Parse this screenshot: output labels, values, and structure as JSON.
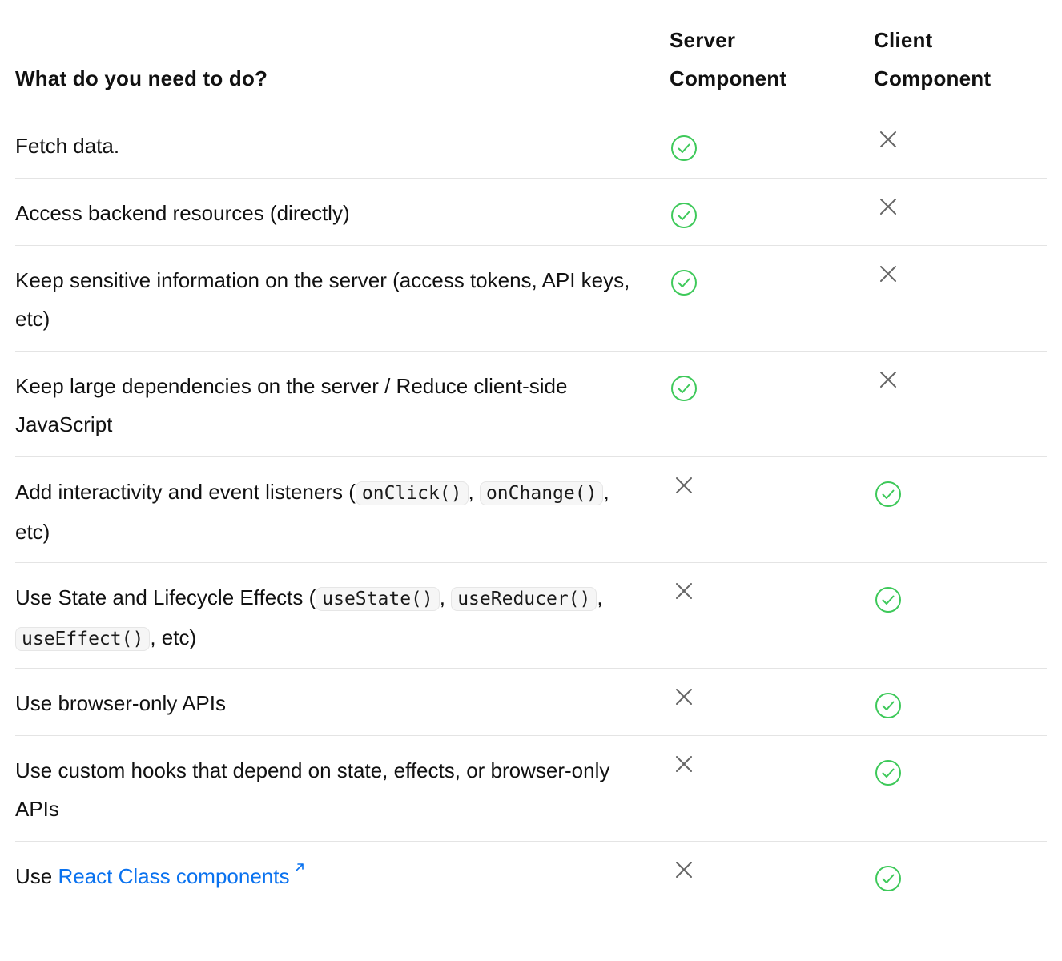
{
  "header": {
    "task_label": "What do you need to do?",
    "server_label_line1": "Server",
    "server_label_line2": "Component",
    "client_label_line1": "Client",
    "client_label_line2": "Component"
  },
  "rows": [
    {
      "text": "Fetch data.",
      "server": "check",
      "client": "cross"
    },
    {
      "text": "Access backend resources (directly)",
      "server": "check",
      "client": "cross"
    },
    {
      "text": "Keep sensitive information on the server (access tokens, API keys, etc)",
      "server": "check",
      "client": "cross"
    },
    {
      "text": "Keep large dependencies on the server / Reduce client-side JavaScript",
      "server": "check",
      "client": "cross"
    },
    {
      "text_before": "Add interactivity and event listeners (",
      "code1": "onClick()",
      "mid1": ", ",
      "code2": "onChange()",
      "text_after": ", etc)",
      "server": "cross",
      "client": "check"
    },
    {
      "text_before": "Use State and Lifecycle Effects (",
      "code1": "useState()",
      "mid1": ", ",
      "code2": "useReducer()",
      "mid2": ", ",
      "code3": "useEffect()",
      "text_after": ", etc)",
      "server": "cross",
      "client": "check"
    },
    {
      "text": "Use browser-only APIs",
      "server": "cross",
      "client": "check"
    },
    {
      "text": "Use custom hooks that depend on state, effects, or browser-only APIs",
      "server": "cross",
      "client": "check"
    },
    {
      "text_before": "Use ",
      "link": "React Class components",
      "server": "cross",
      "client": "check"
    }
  ],
  "colors": {
    "check": "#3ec95a",
    "cross": "#666666",
    "link": "#0a72ef",
    "divider": "#e4e4e4"
  },
  "icons": {
    "check": "check-circle-icon",
    "cross": "x-icon",
    "external": "external-link-icon"
  }
}
